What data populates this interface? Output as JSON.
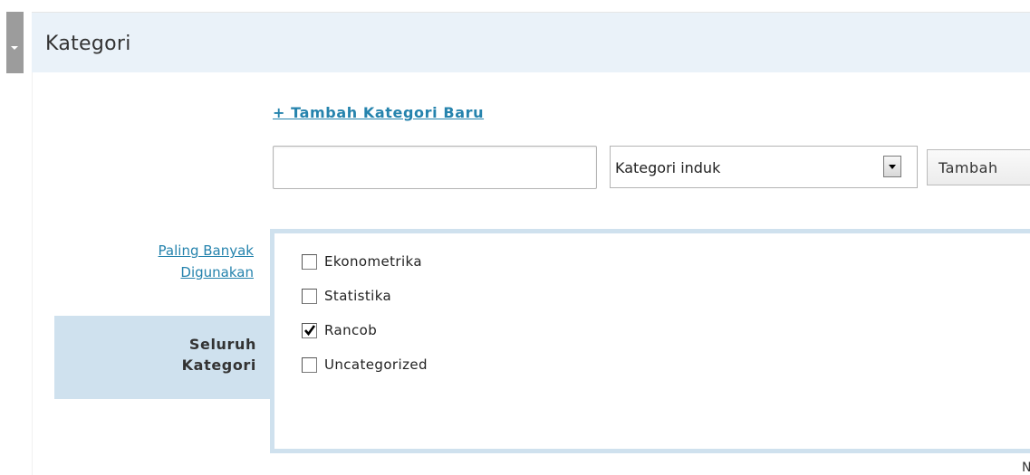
{
  "panel": {
    "title": "Kategori",
    "add_link_label": "+ Tambah Kategori Baru",
    "new_category_value": "",
    "parent_select_value": "Kategori induk",
    "add_button_label": "Tambah"
  },
  "tabs": {
    "popular_line1": "Paling Banyak",
    "popular_line2": "Digunakan",
    "all_line1": "Seluruh",
    "all_line2": "Kategori"
  },
  "categories": [
    {
      "label": "Ekonometrika",
      "checked": false
    },
    {
      "label": "Statistika",
      "checked": false
    },
    {
      "label": "Rancob",
      "checked": true
    },
    {
      "label": "Uncategorized",
      "checked": false
    }
  ],
  "footer_partial_text": "N",
  "colors": {
    "header_bg": "#eaf2f9",
    "link": "#2583ad",
    "tab_active_bg": "#cfe1ee"
  }
}
